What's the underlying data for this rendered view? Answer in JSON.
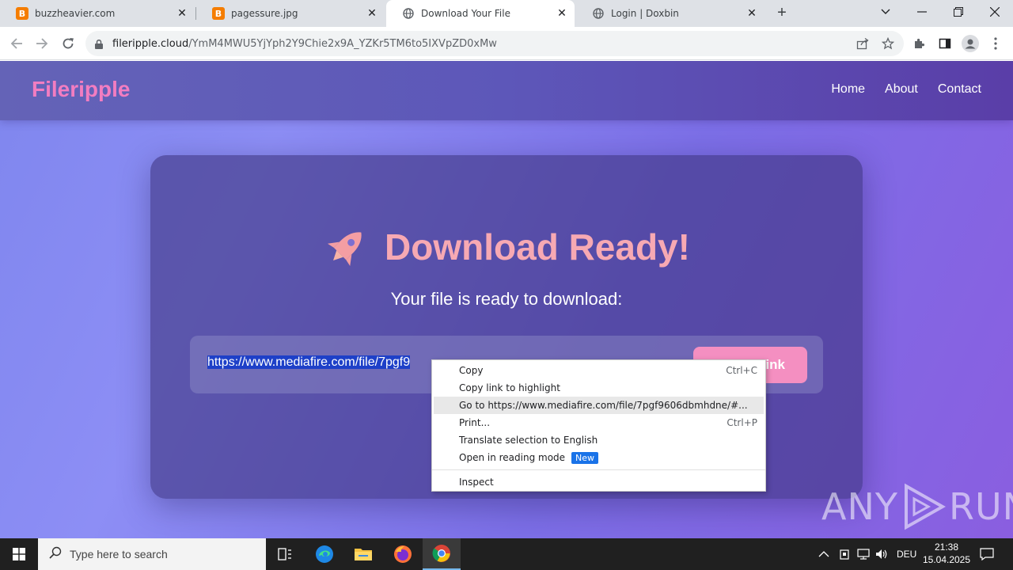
{
  "browser": {
    "tabs": [
      {
        "title": "buzzheavier.com",
        "favicon": "blogger-icon"
      },
      {
        "title": "pagessure.jpg",
        "favicon": "blogger-icon"
      },
      {
        "title": "Download Your File",
        "favicon": "globe-icon"
      },
      {
        "title": "Login | Doxbin",
        "favicon": "globe-icon"
      }
    ],
    "url_host": "fileripple.cloud",
    "url_path": "/YmM4MWU5YjYph2Y9Chie2x9A_YZKr5TM6to5IXVpZD0xMw"
  },
  "site": {
    "logo": "Fileripple",
    "nav": [
      "Home",
      "About",
      "Contact"
    ],
    "title": "Download Ready!",
    "subtitle": "Your file is ready to download:",
    "link_text": "https://www.mediafire.com/file/7pgf9",
    "button_visible_text": "ink",
    "accent_pink": "#f27dc1",
    "title_color": "#f7a9b3"
  },
  "context_menu": {
    "items": [
      {
        "label": "Copy",
        "shortcut": "Ctrl+C"
      },
      {
        "label": "Copy link to highlight",
        "shortcut": ""
      },
      {
        "label": "Go to https://www.mediafire.com/file/7pgf9606dbmhdne/#...",
        "shortcut": ""
      },
      {
        "label": "Print...",
        "shortcut": "Ctrl+P"
      },
      {
        "label": "Translate selection to English",
        "shortcut": ""
      },
      {
        "label": "Open in reading mode",
        "shortcut": "",
        "badge": "New"
      },
      {
        "label": "Inspect",
        "shortcut": ""
      }
    ]
  },
  "watermark": {
    "left": "ANY",
    "right": "RUN"
  },
  "taskbar": {
    "search_placeholder": "Type here to search",
    "language": "DEU",
    "time": "21:38",
    "date": "15.04.2025"
  }
}
